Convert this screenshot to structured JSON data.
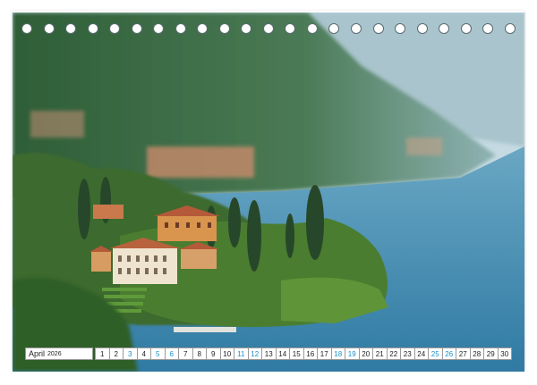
{
  "calendar": {
    "month": "April",
    "year": "2026",
    "days": [
      {
        "n": "1",
        "t": ""
      },
      {
        "n": "2",
        "t": ""
      },
      {
        "n": "3",
        "t": "hol"
      },
      {
        "n": "4",
        "t": ""
      },
      {
        "n": "5",
        "t": "sun"
      },
      {
        "n": "6",
        "t": "hol"
      },
      {
        "n": "7",
        "t": ""
      },
      {
        "n": "8",
        "t": ""
      },
      {
        "n": "9",
        "t": ""
      },
      {
        "n": "10",
        "t": ""
      },
      {
        "n": "11",
        "t": "sat"
      },
      {
        "n": "12",
        "t": "sun"
      },
      {
        "n": "13",
        "t": ""
      },
      {
        "n": "14",
        "t": ""
      },
      {
        "n": "15",
        "t": ""
      },
      {
        "n": "16",
        "t": ""
      },
      {
        "n": "17",
        "t": ""
      },
      {
        "n": "18",
        "t": "sat"
      },
      {
        "n": "19",
        "t": "sun"
      },
      {
        "n": "20",
        "t": ""
      },
      {
        "n": "21",
        "t": ""
      },
      {
        "n": "22",
        "t": ""
      },
      {
        "n": "23",
        "t": ""
      },
      {
        "n": "24",
        "t": ""
      },
      {
        "n": "25",
        "t": "sat"
      },
      {
        "n": "26",
        "t": "sun"
      },
      {
        "n": "27",
        "t": ""
      },
      {
        "n": "28",
        "t": ""
      },
      {
        "n": "29",
        "t": ""
      },
      {
        "n": "30",
        "t": ""
      }
    ]
  },
  "binding_hole_count": 23,
  "colors": {
    "lake": "#3f8fb5",
    "sky": "#c9dde6",
    "mountain": "#3f6f48",
    "villa": "#d9944e",
    "weekend": "#1a8fc8"
  }
}
